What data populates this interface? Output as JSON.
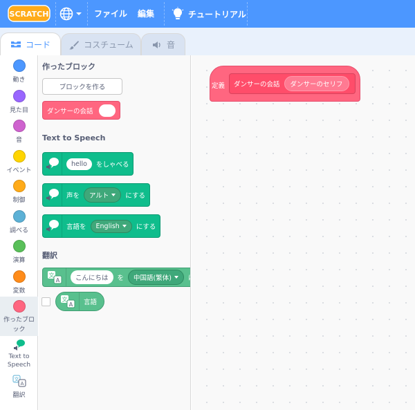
{
  "menubar": {
    "logo_text": "SCRATCH",
    "file_label": "ファイル",
    "edit_label": "編集",
    "tutorials_label": "チュートリアル",
    "colors": {
      "background": "#4c97ff"
    }
  },
  "tabs": [
    {
      "label": "コード",
      "icon": "code-icon",
      "active": true
    },
    {
      "label": "コスチューム",
      "icon": "brush-icon",
      "active": false
    },
    {
      "label": "音",
      "icon": "speaker-icon",
      "active": false
    }
  ],
  "categories": [
    {
      "label": "動き",
      "color": "#4c97ff"
    },
    {
      "label": "見た目",
      "color": "#9966ff"
    },
    {
      "label": "音",
      "color": "#cf63cf"
    },
    {
      "label": "イベント",
      "color": "#ffd500"
    },
    {
      "label": "制御",
      "color": "#ffab19"
    },
    {
      "label": "調べる",
      "color": "#5cb1d6"
    },
    {
      "label": "演算",
      "color": "#59c059"
    },
    {
      "label": "変数",
      "color": "#ff8c1a"
    },
    {
      "label": "作ったブロック",
      "color": "#ff6680",
      "selected": true
    },
    {
      "label": "Text to Speech",
      "icon": "text-to-speech-icon"
    },
    {
      "label": "翻訳",
      "icon": "translate-icon"
    }
  ],
  "flyout": {
    "my_blocks_heading": "作ったブロック",
    "make_block_button": "ブロックを作る",
    "custom_block": {
      "label": "ダンサーの会話"
    },
    "tts_heading": "Text to Speech",
    "tts_speak": {
      "input": "hello",
      "suffix": "をしゃべる"
    },
    "tts_voice": {
      "prefix": "声を",
      "dropdown": "アルト",
      "suffix": "にする"
    },
    "tts_language": {
      "prefix": "言語を",
      "dropdown": "English",
      "suffix": "にする"
    },
    "translate_heading": "翻訳",
    "translate_block": {
      "input": "こんにちは",
      "middle": "を",
      "dropdown": "中国語(繁体)",
      "suffix": "に"
    },
    "language_reporter": {
      "label": "言語"
    }
  },
  "script": {
    "define_label": "定義",
    "proto_label": "ダンサーの会話",
    "proto_arg": "ダンサーのセリフ"
  }
}
